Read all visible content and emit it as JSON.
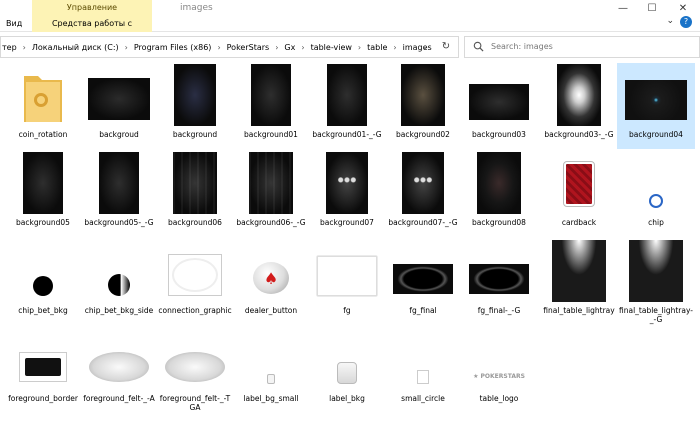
{
  "window": {
    "title": "images",
    "ribbon": {
      "context_header": "Управление",
      "context_tab": "Средства работы с рисунками",
      "view_tab": "Вид"
    }
  },
  "address": {
    "crumbs": [
      "тер",
      "Локальный диск (C:)",
      "Program Files (x86)",
      "PokerStars",
      "Gx",
      "table-view",
      "table",
      "images"
    ]
  },
  "search": {
    "placeholder": "Search: images"
  },
  "files": [
    {
      "name": "coin_rotation",
      "kind": "folder"
    },
    {
      "name": "backgroud",
      "kind": "dark-wide"
    },
    {
      "name": "background",
      "kind": "dark-tall-blue"
    },
    {
      "name": "background01",
      "kind": "dark-tall"
    },
    {
      "name": "background01-_-G",
      "kind": "dark-tall"
    },
    {
      "name": "background02",
      "kind": "dark-tall-warm"
    },
    {
      "name": "background03",
      "kind": "dark-wide-small"
    },
    {
      "name": "background03-_-G",
      "kind": "light-spot"
    },
    {
      "name": "background04",
      "kind": "dark-dot"
    },
    {
      "name": "background05",
      "kind": "dark-tall"
    },
    {
      "name": "background05-_-G",
      "kind": "dark-tall"
    },
    {
      "name": "background06",
      "kind": "dark-tall-lines"
    },
    {
      "name": "background06-_-G",
      "kind": "dark-tall-lines"
    },
    {
      "name": "background07",
      "kind": "dark-tall-lights"
    },
    {
      "name": "background07-_-G",
      "kind": "dark-tall-lights"
    },
    {
      "name": "background08",
      "kind": "dark-tall-red"
    },
    {
      "name": "cardback",
      "kind": "cardback"
    },
    {
      "name": "chip",
      "kind": "chip"
    },
    {
      "name": "chip_bet_bkg",
      "kind": "black-circle"
    },
    {
      "name": "chip_bet_bkg_side",
      "kind": "half-circle"
    },
    {
      "name": "connection_graphic",
      "kind": "white-oval"
    },
    {
      "name": "dealer_button",
      "kind": "dealer"
    },
    {
      "name": "fg",
      "kind": "white-rect"
    },
    {
      "name": "fg_final",
      "kind": "table-lights"
    },
    {
      "name": "fg_final-_-G",
      "kind": "table-lights"
    },
    {
      "name": "final_table_lightray",
      "kind": "lightray"
    },
    {
      "name": "final_table_lightray-_-G",
      "kind": "lightray"
    },
    {
      "name": "foreground_border",
      "kind": "fg-border"
    },
    {
      "name": "foreground_felt-_-A",
      "kind": "felt"
    },
    {
      "name": "foreground_felt-_-TGA",
      "kind": "felt"
    },
    {
      "name": "label_bg_small",
      "kind": "tiny-label"
    },
    {
      "name": "label_bkg",
      "kind": "label-bkg"
    },
    {
      "name": "small_circle",
      "kind": "tiny-square"
    },
    {
      "name": "table_logo",
      "kind": "logo"
    }
  ],
  "logo_text": "POKERSTARS",
  "selected": "background04"
}
